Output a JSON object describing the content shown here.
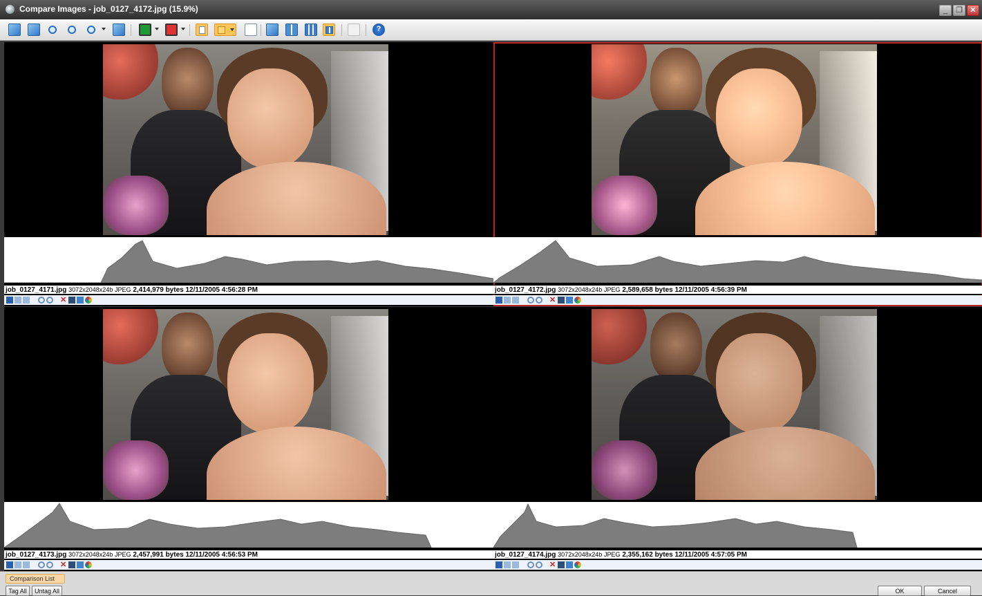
{
  "window": {
    "title": "Compare Images - job_0127_4172.jpg (15.9%)"
  },
  "toolbar": {
    "icons": [
      "prev-image-icon",
      "next-image-icon",
      "zoom-in-icon",
      "zoom-out-icon",
      "zoom-menu-icon",
      "fit-icon",
      "green-color-icon",
      "red-color-icon",
      "page-icon",
      "histogram-icon",
      "properties-icon",
      "single-view-icon",
      "two-up-icon",
      "three-up-icon",
      "four-up-icon",
      "clipboard-icon",
      "help-icon"
    ]
  },
  "panels": [
    {
      "filename": "job_0127_4171.jpg",
      "dimensions": "3072x2048x24b",
      "format": "JPEG",
      "size": "2,414,979 bytes",
      "date": "12/11/2005 4:56:28 PM",
      "selected": false,
      "tone": "neutral"
    },
    {
      "filename": "job_0127_4172.jpg",
      "dimensions": "3072x2048x24b",
      "format": "JPEG",
      "size": "2,589,658 bytes",
      "date": "12/11/2005 4:56:39 PM",
      "selected": true,
      "tone": "warm"
    },
    {
      "filename": "job_0127_4173.jpg",
      "dimensions": "3072x2048x24b",
      "format": "JPEG",
      "size": "2,457,991 bytes",
      "date": "12/11/2005 4:56:53 PM",
      "selected": false,
      "tone": "neutral"
    },
    {
      "filename": "job_0127_4174.jpg",
      "dimensions": "3072x2048x24b",
      "format": "JPEG",
      "size": "2,355,162 bytes",
      "date": "12/11/2005 4:57:05 PM",
      "selected": false,
      "tone": "dark"
    }
  ],
  "bottom": {
    "comparison_list": "Comparison List",
    "tag_all": "Tag All",
    "untag_all": "Untag All",
    "ok": "OK",
    "cancel": "Cancel"
  },
  "colors": {
    "selected_border": "#b22222",
    "active_toolbar": "#fbc55a"
  }
}
